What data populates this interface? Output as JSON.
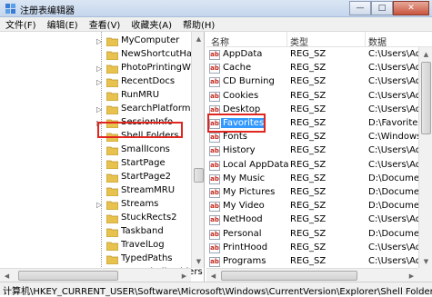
{
  "window": {
    "title": "注册表编辑器",
    "minimize": "—",
    "maximize": "□",
    "close": "✕"
  },
  "menu": [
    "文件(F)",
    "编辑(E)",
    "查看(V)",
    "收藏夹(A)",
    "帮助(H)"
  ],
  "tree": {
    "items": [
      {
        "label": "MyComputer",
        "expander": "▷"
      },
      {
        "label": "NewShortcutHandl",
        "expander": ""
      },
      {
        "label": "PhotoPrintingWiza",
        "expander": "▷"
      },
      {
        "label": "RecentDocs",
        "expander": "▷"
      },
      {
        "label": "RunMRU",
        "expander": ""
      },
      {
        "label": "SearchPlatform",
        "expander": "▷"
      },
      {
        "label": "SessionInfo",
        "expander": "▷"
      },
      {
        "label": "Shell Folders",
        "expander": "",
        "selected": true
      },
      {
        "label": "SmallIcons",
        "expander": ""
      },
      {
        "label": "StartPage",
        "expander": ""
      },
      {
        "label": "StartPage2",
        "expander": ""
      },
      {
        "label": "StreamMRU",
        "expander": ""
      },
      {
        "label": "Streams",
        "expander": "▷"
      },
      {
        "label": "StuckRects2",
        "expander": ""
      },
      {
        "label": "Taskband",
        "expander": ""
      },
      {
        "label": "TravelLog",
        "expander": ""
      },
      {
        "label": "TypedPaths",
        "expander": ""
      },
      {
        "label": "User Shell Folders",
        "expander": ""
      }
    ]
  },
  "list": {
    "headers": {
      "name": "名称",
      "type": "类型",
      "data": "数据"
    },
    "rows": [
      {
        "name": "AppData",
        "type": "REG_SZ",
        "data": "C:\\Users\\Adr"
      },
      {
        "name": "Cache",
        "type": "REG_SZ",
        "data": "C:\\Users\\Adr"
      },
      {
        "name": "CD Burning",
        "type": "REG_SZ",
        "data": "C:\\Users\\Adr"
      },
      {
        "name": "Cookies",
        "type": "REG_SZ",
        "data": "C:\\Users\\Adr"
      },
      {
        "name": "Desktop",
        "type": "REG_SZ",
        "data": "C:\\Users\\Adr"
      },
      {
        "name": "Favorites",
        "type": "REG_SZ",
        "data": "D:\\Favorites",
        "selected": true
      },
      {
        "name": "Fonts",
        "type": "REG_SZ",
        "data": "C:\\Windows\\"
      },
      {
        "name": "History",
        "type": "REG_SZ",
        "data": "C:\\Users\\Adr"
      },
      {
        "name": "Local AppData",
        "type": "REG_SZ",
        "data": "C:\\Users\\Adr"
      },
      {
        "name": "My Music",
        "type": "REG_SZ",
        "data": "D:\\Documen"
      },
      {
        "name": "My Pictures",
        "type": "REG_SZ",
        "data": "D:\\Documen"
      },
      {
        "name": "My Video",
        "type": "REG_SZ",
        "data": "D:\\Documen"
      },
      {
        "name": "NetHood",
        "type": "REG_SZ",
        "data": "C:\\Users\\Adr"
      },
      {
        "name": "Personal",
        "type": "REG_SZ",
        "data": "D:\\Documen"
      },
      {
        "name": "PrintHood",
        "type": "REG_SZ",
        "data": "C:\\Users\\Adr"
      },
      {
        "name": "Programs",
        "type": "REG_SZ",
        "data": "C:\\Users\\Adr"
      }
    ]
  },
  "status": {
    "path": "计算机\\HKEY_CURRENT_USER\\Software\\Microsoft\\Windows\\CurrentVersion\\Explorer\\Shell Folders"
  },
  "colors": {
    "highlight_box": "#e0261f",
    "selection": "#3399ff"
  }
}
